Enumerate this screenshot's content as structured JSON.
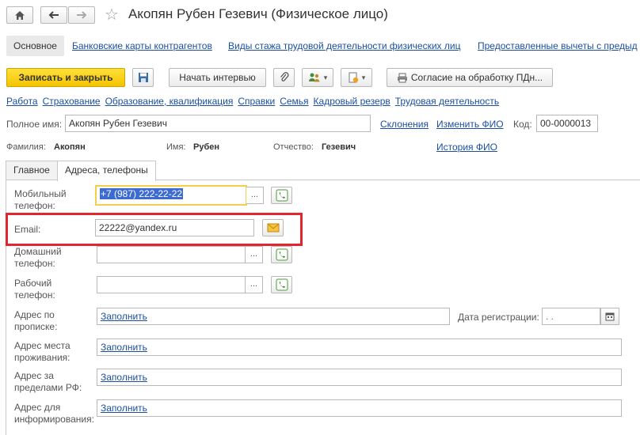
{
  "window": {
    "title": "Акопян Рубен Гезевич (Физическое лицо)",
    "home_icon": "home-icon",
    "back_icon": "arrow-left-icon",
    "forward_icon": "arrow-right-icon",
    "star_icon": "star-icon",
    "star_glyph": "☆"
  },
  "topnav": {
    "items": [
      {
        "label": "Основное"
      },
      {
        "label": "Банковские карты контрагентов"
      },
      {
        "label": "Виды стажа трудовой деятельности физических лиц"
      },
      {
        "label": "Предоставленные вычеты с предыд"
      }
    ]
  },
  "toolbar": {
    "save_close": "Записать и закрыть",
    "interview": "Начать интервью",
    "consent": "Согласие на обработку ПДн...",
    "dropdown_arrow": "▾"
  },
  "sublinks": [
    "Работа",
    "Страхование",
    "Образование, квалификация",
    "Справки",
    "Семья",
    "Кадровый резерв",
    "Трудовая деятельность"
  ],
  "person": {
    "fullname_label": "Полное имя:",
    "fullname_value": "Акопян Рубен Гезевич",
    "declension_link": "Склонения",
    "change_name_link": "Изменить ФИО",
    "code_label": "Код:",
    "code_value": "00-0000013",
    "surname_label": "Фамилия:",
    "surname_value": "Акопян",
    "name_label": "Имя:",
    "name_value": "Рубен",
    "patronymic_label": "Отчество:",
    "patronymic_value": "Гезевич",
    "history_link": "История ФИО"
  },
  "tabs": [
    {
      "label": "Главное"
    },
    {
      "label": "Адреса, телефоны"
    }
  ],
  "contacts": {
    "mobile_label_1": "Мобильный",
    "mobile_label_2": "телефон:",
    "mobile_value": "+7 (987) 222-22-22",
    "email_label": "Email:",
    "email_value": "22222@yandex.ru",
    "home_label_1": "Домашний",
    "home_label_2": "телефон:",
    "work_label_1": "Рабочий",
    "work_label_2": "телефон:",
    "ellipsis": "...",
    "reg_addr_label_1": "Адрес по",
    "reg_addr_label_2": "прописке:",
    "reg_date_label": "Дата регистрации:",
    "reg_date_value": " .  .",
    "live_addr_label_1": "Адрес места",
    "live_addr_label_2": "проживания:",
    "abroad_addr_label_1": "Адрес за",
    "abroad_addr_label_2": "пределами РФ:",
    "info_addr_label_1": "Адрес для",
    "info_addr_label_2": "информирования:",
    "fill_link": "Заполнить"
  },
  "colors": {
    "accent_yellow": "#f5c400",
    "highlight_red": "#e3262d",
    "link_blue": "#1c4fa0",
    "selection_blue": "#3c6bd1"
  }
}
